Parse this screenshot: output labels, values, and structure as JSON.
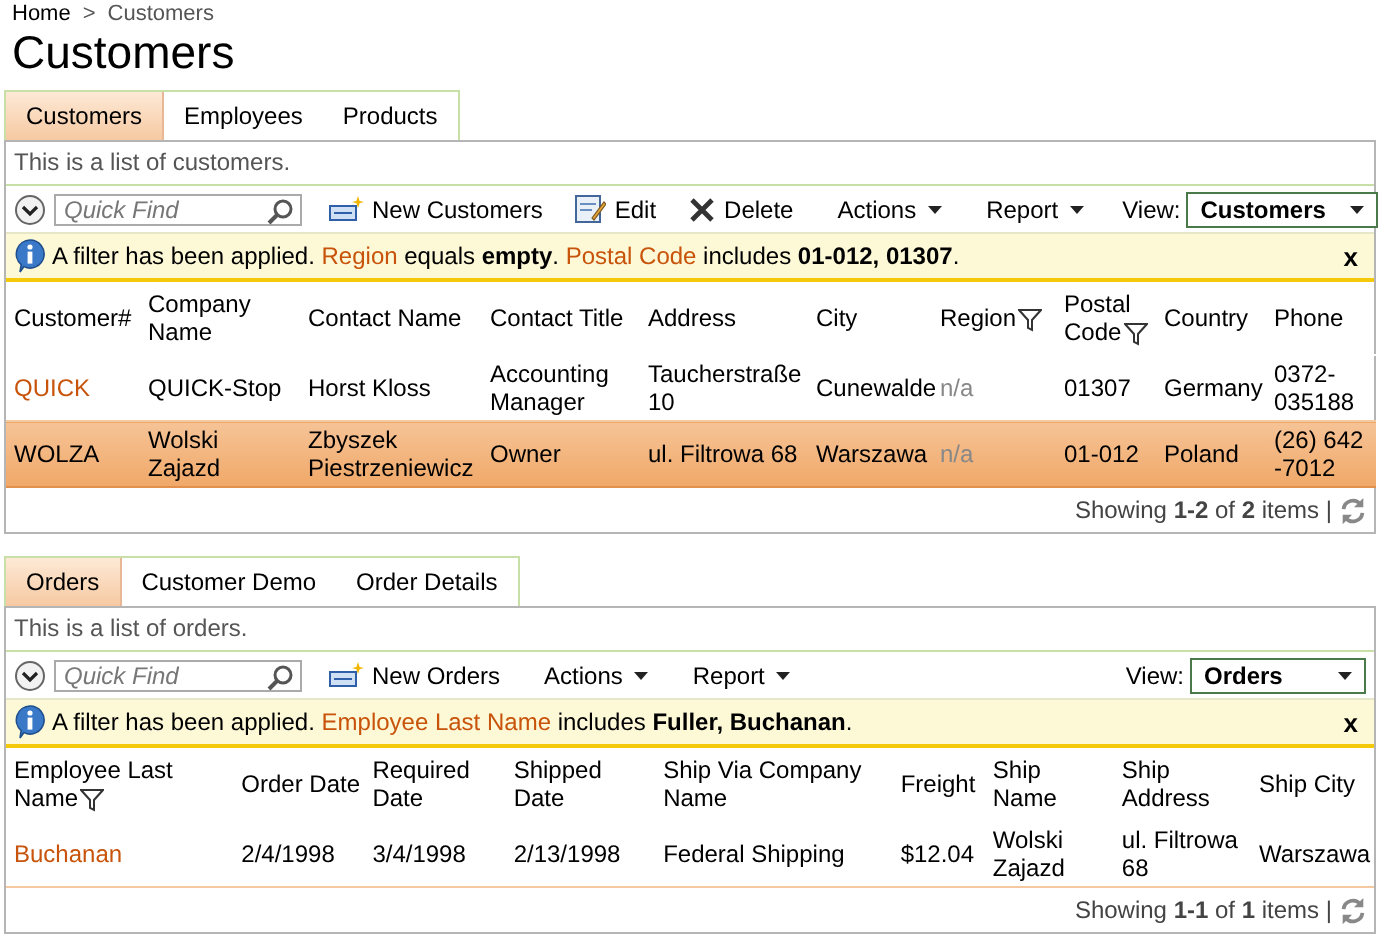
{
  "breadcrumb": {
    "items": [
      "Home",
      "Customers"
    ],
    "separator": ">"
  },
  "title": "Customers",
  "panels": [
    {
      "tabs": [
        {
          "label": "Customers",
          "selected": true
        },
        {
          "label": "Employees",
          "selected": false
        },
        {
          "label": "Products",
          "selected": false
        }
      ],
      "description": "This is a list of customers.",
      "toolbar": {
        "search_placeholder": "Quick Find",
        "buttons": [
          {
            "label": "New Customers",
            "kind": "new"
          },
          {
            "label": "Edit",
            "kind": "edit"
          },
          {
            "label": "Delete",
            "kind": "delete"
          },
          {
            "label": "Actions",
            "kind": "menu"
          },
          {
            "label": "Report",
            "kind": "menu"
          }
        ],
        "view_label": "View:",
        "view_value": "Customers"
      },
      "filter": {
        "parts": [
          {
            "text": "A filter has been applied. ",
            "kind": "plain"
          },
          {
            "text": "Region",
            "kind": "field"
          },
          {
            "text": " equals ",
            "kind": "plain"
          },
          {
            "text": "empty",
            "kind": "value"
          },
          {
            "text": ". ",
            "kind": "plain"
          },
          {
            "text": "Postal Code",
            "kind": "field"
          },
          {
            "text": " includes ",
            "kind": "plain"
          },
          {
            "text": "01-012, 01307",
            "kind": "value"
          },
          {
            "text": ".",
            "kind": "plain"
          }
        ],
        "close": "x"
      },
      "columns": [
        {
          "label": "Customer#",
          "filtered": false,
          "kind": "link"
        },
        {
          "label": "Company Name",
          "filtered": false,
          "kind": "text"
        },
        {
          "label": "Contact Name",
          "filtered": false,
          "kind": "text"
        },
        {
          "label": "Contact Title",
          "filtered": false,
          "kind": "text"
        },
        {
          "label": "Address",
          "filtered": false,
          "kind": "text"
        },
        {
          "label": "City",
          "filtered": false,
          "kind": "text"
        },
        {
          "label": "Region",
          "filtered": true,
          "kind": "muted"
        },
        {
          "label": "Postal Code",
          "filtered": true,
          "kind": "text"
        },
        {
          "label": "Country",
          "filtered": false,
          "kind": "text"
        },
        {
          "label": "Phone",
          "filtered": false,
          "kind": "text"
        }
      ],
      "rows": [
        {
          "selected": false,
          "cells": [
            "QUICK",
            "QUICK-Stop",
            "Horst Kloss",
            "Accounting Manager",
            "Taucherstraße 10",
            "Cunewalde",
            "n/a",
            "01307",
            "Germany",
            "0372-035188"
          ]
        },
        {
          "selected": true,
          "cells": [
            "WOLZA",
            "Wolski Zajazd",
            "Zbyszek Piestrzeniewicz",
            "Owner",
            "ul. Filtrowa 68",
            "Warszawa",
            "n/a",
            "01-012",
            "Poland",
            "(26) 642 -7012"
          ]
        }
      ],
      "footer": "Showing **1-2** of **2** items |"
    },
    {
      "tabs": [
        {
          "label": "Orders",
          "selected": true
        },
        {
          "label": "Customer Demo",
          "selected": false
        },
        {
          "label": "Order Details",
          "selected": false
        }
      ],
      "description": "This is a list of orders.",
      "toolbar": {
        "search_placeholder": "Quick Find",
        "buttons": [
          {
            "label": "New Orders",
            "kind": "new"
          },
          {
            "label": "Actions",
            "kind": "menu"
          },
          {
            "label": "Report",
            "kind": "menu"
          }
        ],
        "view_label": "View:",
        "view_value": "Orders"
      },
      "filter": {
        "parts": [
          {
            "text": "A filter has been applied. ",
            "kind": "plain"
          },
          {
            "text": "Employee Last Name",
            "kind": "field"
          },
          {
            "text": " includes ",
            "kind": "plain"
          },
          {
            "text": "Fuller, Buchanan",
            "kind": "value"
          },
          {
            "text": ".",
            "kind": "plain"
          }
        ],
        "close": "x"
      },
      "columns": [
        {
          "label": "Employee Last Name",
          "filtered": true,
          "kind": "link"
        },
        {
          "label": "Order Date",
          "filtered": false,
          "kind": "text"
        },
        {
          "label": "Required Date",
          "filtered": false,
          "kind": "text"
        },
        {
          "label": "Shipped Date",
          "filtered": false,
          "kind": "text"
        },
        {
          "label": "Ship Via Company Name",
          "filtered": false,
          "kind": "text"
        },
        {
          "label": "Freight",
          "filtered": false,
          "kind": "text"
        },
        {
          "label": "Ship Name",
          "filtered": false,
          "kind": "text"
        },
        {
          "label": "Ship Address",
          "filtered": false,
          "kind": "text"
        },
        {
          "label": "Ship City",
          "filtered": false,
          "kind": "text"
        }
      ],
      "rows": [
        {
          "selected": false,
          "cells": [
            "Buchanan",
            "2/4/1998",
            "3/4/1998",
            "2/13/1998",
            "Federal Shipping",
            "$12.04",
            "Wolski Zajazd",
            "ul. Filtrowa 68",
            "Warszawa"
          ]
        }
      ],
      "footer": "Showing **1-1** of **1** items |"
    }
  ]
}
